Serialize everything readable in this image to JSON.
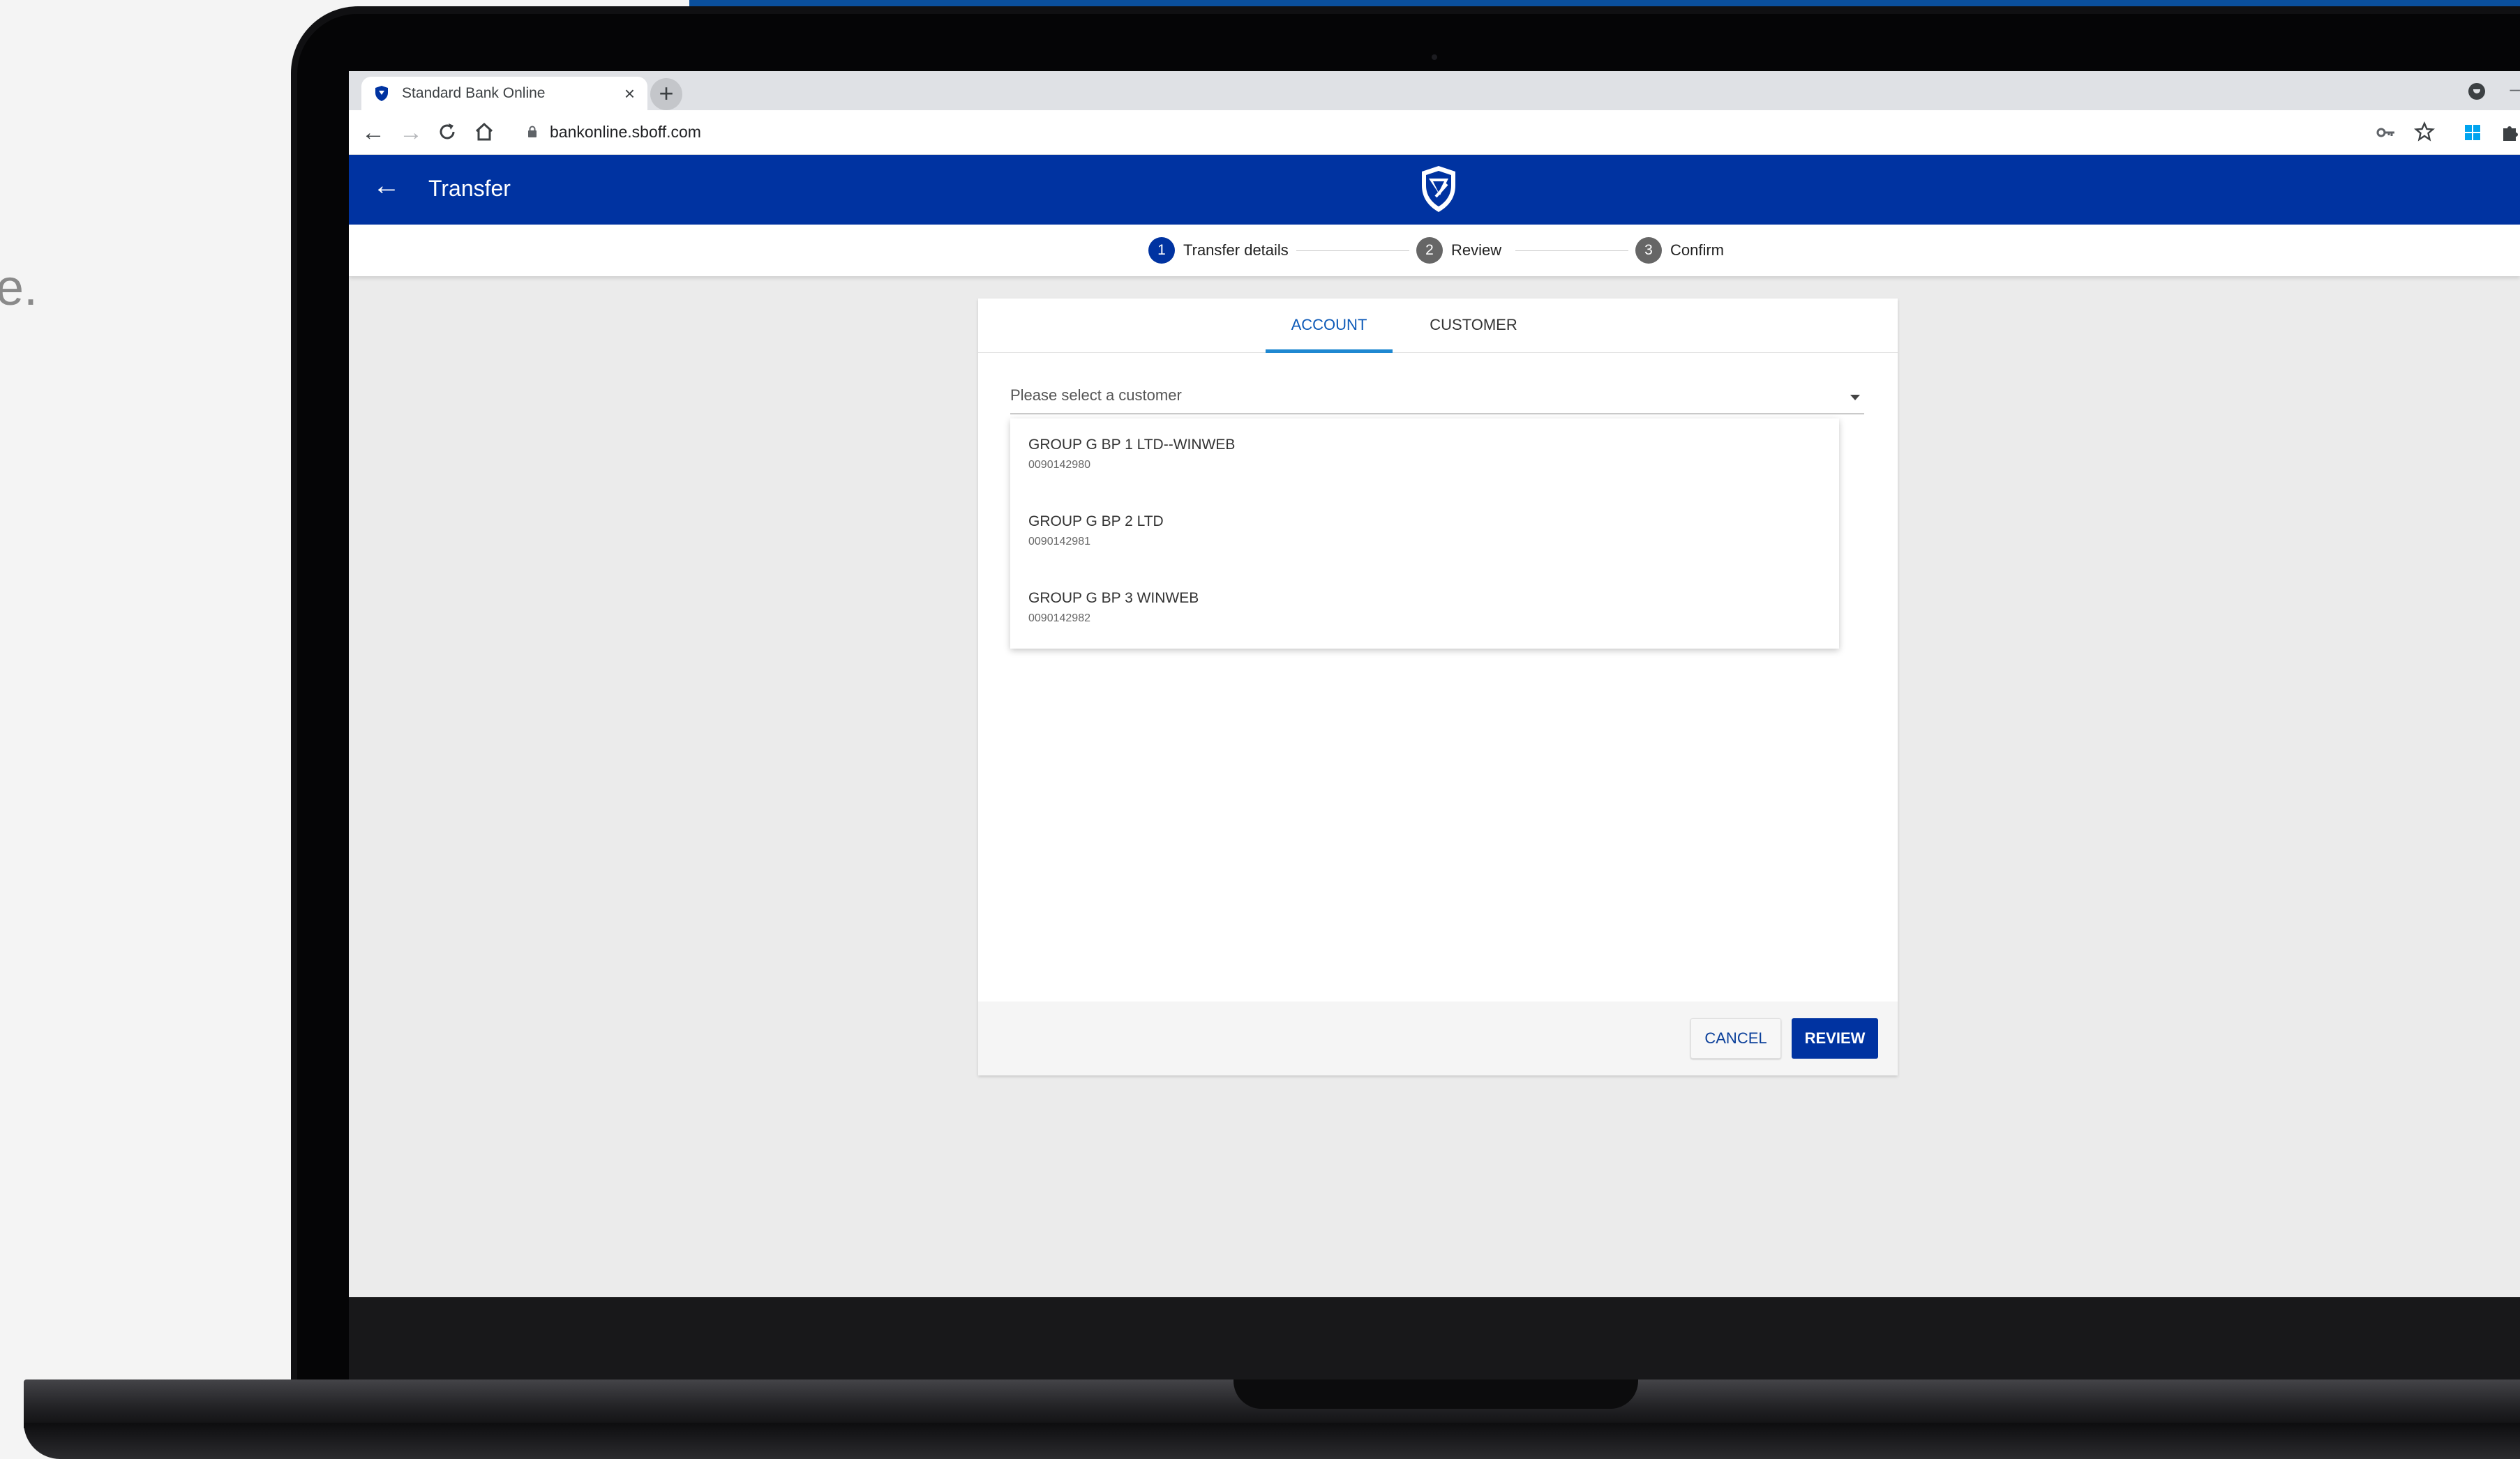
{
  "background": {
    "partial_text": "e."
  },
  "browser": {
    "tab_title": "Standard Bank Online",
    "tab_close": "×",
    "new_tab": "+",
    "minimize": "–",
    "url": "bankonline.sboff.com"
  },
  "app": {
    "title": "Transfer",
    "back": "←",
    "brand_color": "#0033a1"
  },
  "stepper": {
    "steps": [
      {
        "number": "1",
        "label": "Transfer details",
        "state": "active"
      },
      {
        "number": "2",
        "label": "Review",
        "state": "inactive"
      },
      {
        "number": "3",
        "label": "Confirm",
        "state": "inactive"
      }
    ]
  },
  "card": {
    "tabs": [
      {
        "label": "ACCOUNT",
        "active": true
      },
      {
        "label": "CUSTOMER",
        "active": false
      }
    ],
    "select": {
      "placeholder": "Please select a customer"
    },
    "options": [
      {
        "name": "GROUP G BP 1 LTD--WINWEB",
        "account": "0090142980"
      },
      {
        "name": "GROUP G BP 2 LTD",
        "account": "0090142981"
      },
      {
        "name": "GROUP G BP 3 WINWEB",
        "account": "0090142982"
      }
    ],
    "buttons": {
      "cancel": "CANCEL",
      "review": "REVIEW"
    }
  }
}
